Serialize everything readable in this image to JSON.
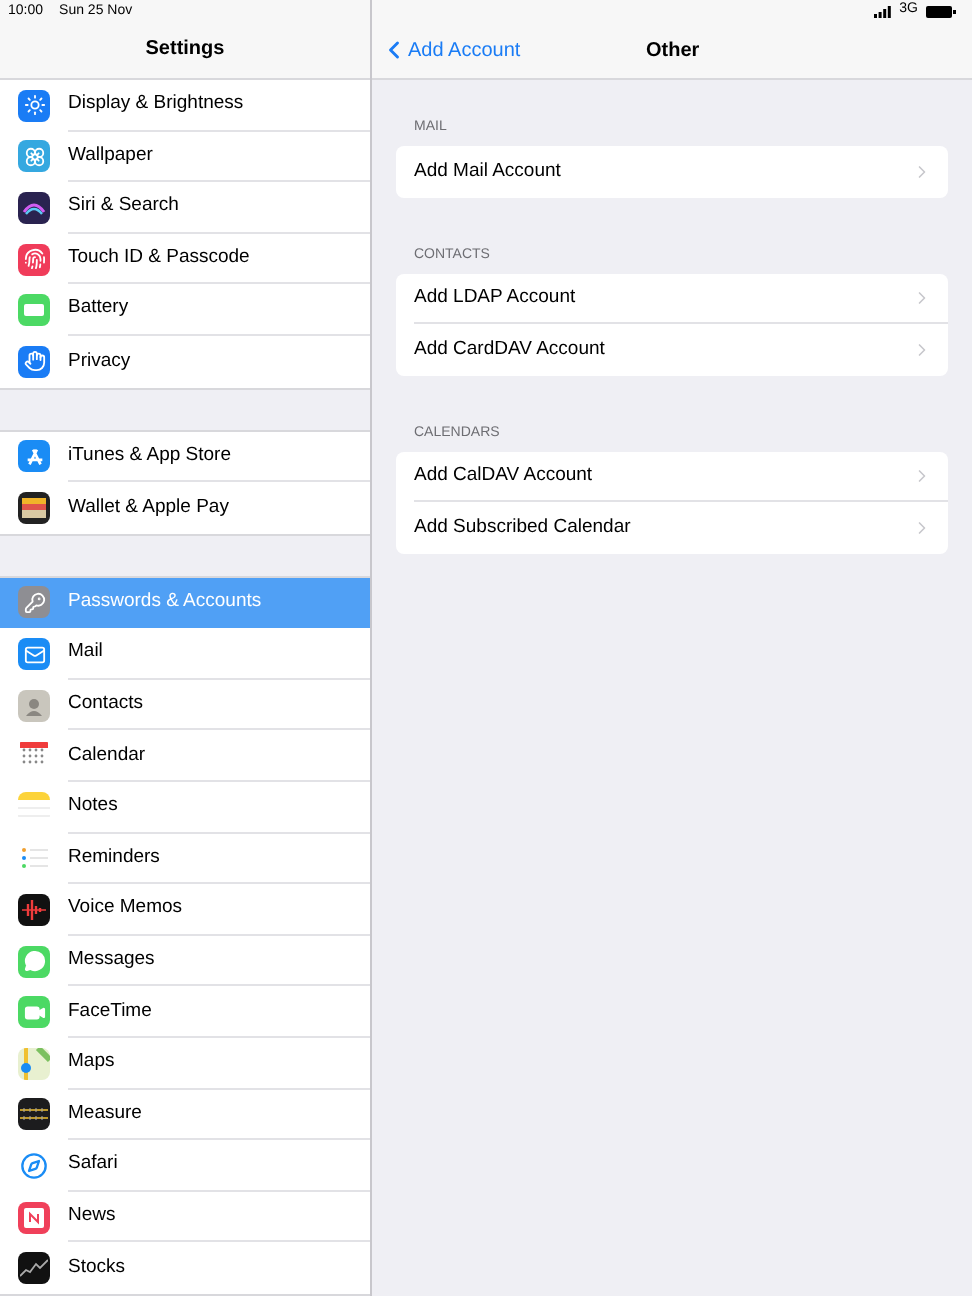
{
  "status_bar": {
    "time": "10:00",
    "date": "Sun 25 Nov",
    "network": "3G"
  },
  "sidebar": {
    "title": "Settings",
    "groups": [
      [
        {
          "label": "Display & Brightness",
          "kind": "display",
          "selected": false
        },
        {
          "label": "Wallpaper",
          "kind": "wallpaper",
          "selected": false
        },
        {
          "label": "Siri & Search",
          "kind": "siri",
          "selected": false
        },
        {
          "label": "Touch ID & Passcode",
          "kind": "touchid",
          "selected": false
        },
        {
          "label": "Battery",
          "kind": "battery",
          "selected": false
        },
        {
          "label": "Privacy",
          "kind": "privacy",
          "selected": false
        }
      ],
      [
        {
          "label": "iTunes & App Store",
          "kind": "appstore",
          "selected": false
        },
        {
          "label": "Wallet & Apple Pay",
          "kind": "wallet",
          "selected": false
        }
      ],
      [
        {
          "label": "Passwords & Accounts",
          "kind": "passwords",
          "selected": true
        },
        {
          "label": "Mail",
          "kind": "mail",
          "selected": false
        },
        {
          "label": "Contacts",
          "kind": "contacts",
          "selected": false
        },
        {
          "label": "Calendar",
          "kind": "calendar",
          "selected": false
        },
        {
          "label": "Notes",
          "kind": "notes",
          "selected": false
        },
        {
          "label": "Reminders",
          "kind": "reminders",
          "selected": false
        },
        {
          "label": "Voice Memos",
          "kind": "voicememos",
          "selected": false
        },
        {
          "label": "Messages",
          "kind": "messages",
          "selected": false
        },
        {
          "label": "FaceTime",
          "kind": "facetime",
          "selected": false
        },
        {
          "label": "Maps",
          "kind": "maps",
          "selected": false
        },
        {
          "label": "Measure",
          "kind": "measure",
          "selected": false
        },
        {
          "label": "Safari",
          "kind": "safari",
          "selected": false
        },
        {
          "label": "News",
          "kind": "news",
          "selected": false
        },
        {
          "label": "Stocks",
          "kind": "stocks",
          "selected": false
        }
      ]
    ]
  },
  "detail": {
    "back": "Add Account",
    "title": "Other",
    "sections": [
      {
        "header": "MAIL",
        "items": [
          "Add Mail Account"
        ]
      },
      {
        "header": "CONTACTS",
        "items": [
          "Add LDAP Account",
          "Add CardDAV Account"
        ]
      },
      {
        "header": "CALENDARS",
        "items": [
          "Add CalDAV Account",
          "Add Subscribed Calendar"
        ]
      }
    ]
  }
}
